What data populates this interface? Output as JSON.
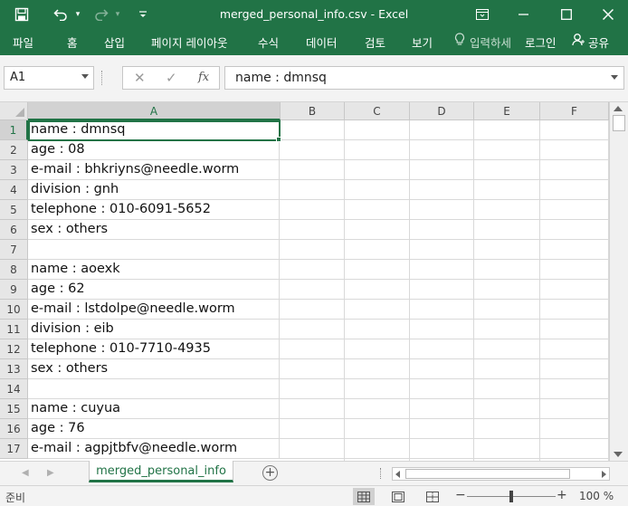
{
  "titlebar": {
    "title": "merged_personal_info.csv - Excel",
    "undo_dropdown": "▾",
    "customize_qat": "▾"
  },
  "ribbon": {
    "tabs": [
      "파일",
      "홈",
      "삽입",
      "페이지 레이아웃",
      "수식",
      "데이터",
      "검토",
      "보기"
    ],
    "tell_me": "입력하세",
    "login": "로그인",
    "share": "공유"
  },
  "formula_bar": {
    "name_box": "A1",
    "cancel": "✕",
    "enter": "✓",
    "fx": "fx",
    "formula": "name : dmnsq"
  },
  "grid": {
    "columns": [
      "A",
      "B",
      "C",
      "D",
      "E",
      "F"
    ],
    "selected_cell": "A1",
    "rows": [
      {
        "num": "1",
        "a": "name : dmnsq"
      },
      {
        "num": "2",
        "a": "age : 08"
      },
      {
        "num": "3",
        "a": "e-mail : bhkriyns@needle.worm"
      },
      {
        "num": "4",
        "a": "division : gnh"
      },
      {
        "num": "5",
        "a": "telephone : 010-6091-5652"
      },
      {
        "num": "6",
        "a": "sex : others"
      },
      {
        "num": "7",
        "a": ""
      },
      {
        "num": "8",
        "a": "name : aoexk"
      },
      {
        "num": "9",
        "a": "age : 62"
      },
      {
        "num": "10",
        "a": "e-mail : lstdolpe@needle.worm"
      },
      {
        "num": "11",
        "a": "division : eib"
      },
      {
        "num": "12",
        "a": "telephone : 010-7710-4935"
      },
      {
        "num": "13",
        "a": "sex : others"
      },
      {
        "num": "14",
        "a": ""
      },
      {
        "num": "15",
        "a": "name : cuyua"
      },
      {
        "num": "16",
        "a": "age : 76"
      },
      {
        "num": "17",
        "a": "e-mail : agpjtbfv@needle.worm"
      }
    ]
  },
  "sheets": {
    "active": "merged_personal_info",
    "add_label": "+"
  },
  "status": {
    "ready": "준비",
    "zoom_minus": "−",
    "zoom_plus": "+",
    "zoom": "100 %",
    "zoom_fraction": 0.5
  },
  "colors": {
    "accent": "#217346",
    "gridline": "#d9d9d9",
    "header_bg": "#e6e6e6"
  }
}
